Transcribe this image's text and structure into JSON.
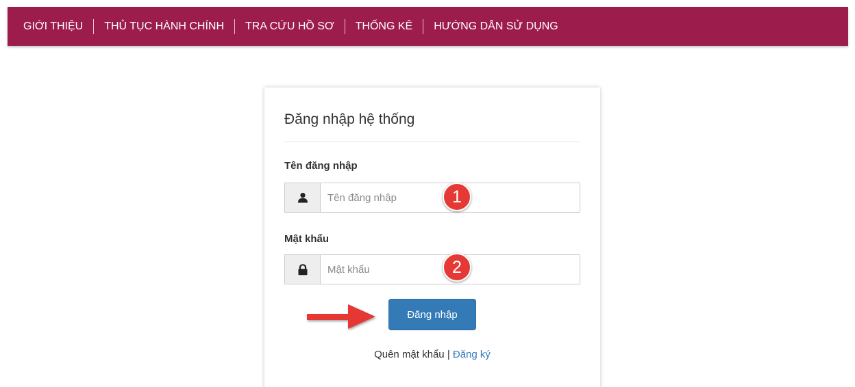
{
  "nav": {
    "items": [
      {
        "label": "GIỚI THIỆU"
      },
      {
        "label": "THỦ TỤC HÀNH CHÍNH"
      },
      {
        "label": "TRA CỨU HỒ SƠ"
      },
      {
        "label": "THỐNG KÊ"
      },
      {
        "label": "HƯỚNG DẪN SỬ DỤNG"
      }
    ],
    "background": "#9c1d4b"
  },
  "login": {
    "title": "Đăng nhập hệ thống",
    "username": {
      "label": "Tên đăng nhập",
      "placeholder": "Tên đăng nhập",
      "value": "",
      "icon": "user-icon"
    },
    "password": {
      "label": "Mật khẩu",
      "placeholder": "Mật khẩu",
      "value": "",
      "icon": "lock-icon"
    },
    "submit_label": "Đăng nhập",
    "forgot_label": "Quên mật khẩu",
    "separator": "|",
    "register_label": "Đăng ký",
    "accent": "#337ab7"
  },
  "annotations": {
    "step1": "1",
    "step2": "2",
    "badge_color": "#e53935",
    "arrow_icon": "right-arrow-icon"
  }
}
